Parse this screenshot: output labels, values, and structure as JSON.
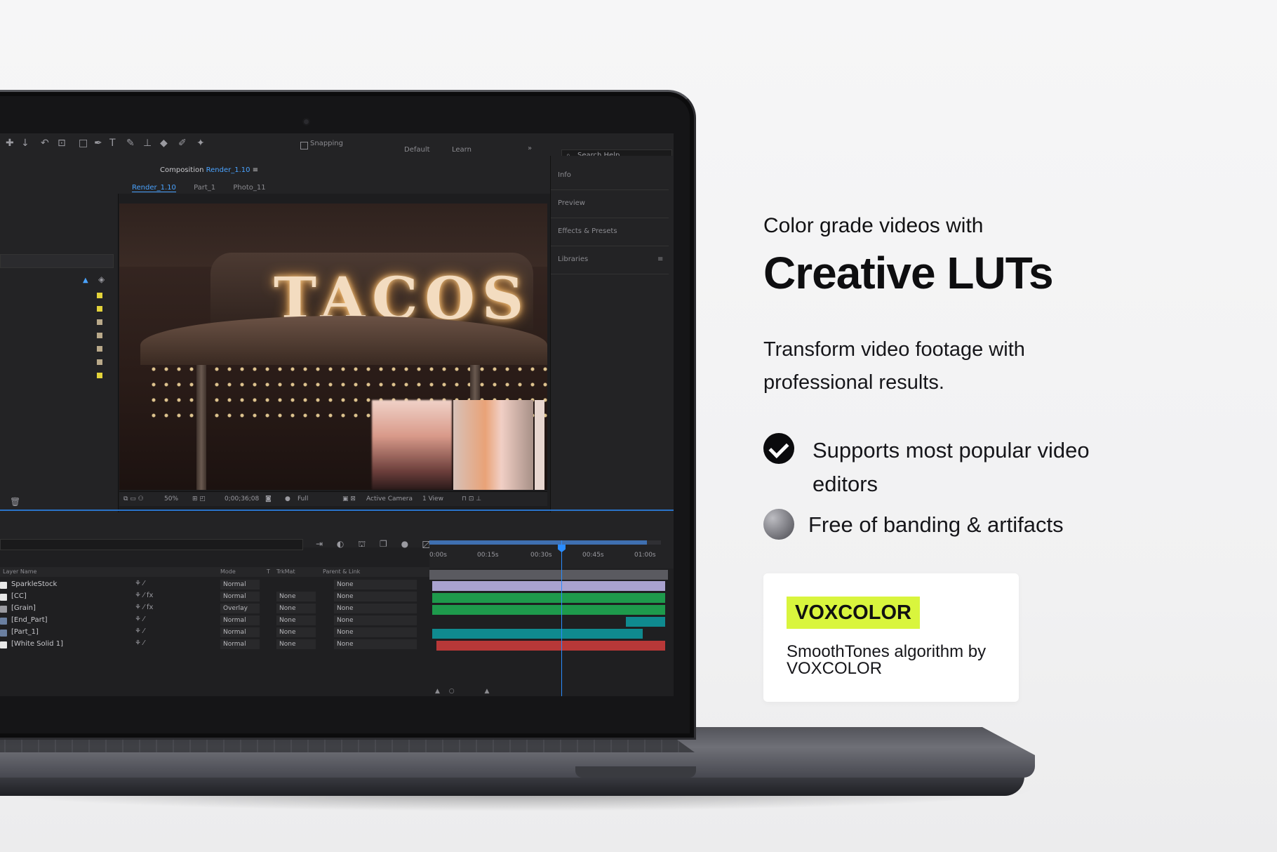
{
  "app": {
    "toolbar": {
      "snapping": "Snapping",
      "workspace_default": "Default",
      "workspace_learn": "Learn",
      "search_placeholder": "Search Help"
    },
    "composition": {
      "label": "Composition",
      "name": "Render_1.10",
      "tabs": [
        "Render_1.10",
        "Part_1",
        "Photo_11"
      ]
    },
    "viewer": {
      "sign_text": "TACOS",
      "zoom": "50%",
      "timecode": "0;00;36;08",
      "resolution": "Full",
      "camera": "Active Camera",
      "views": "1 View"
    },
    "right_panel": [
      "Info",
      "Preview",
      "Effects & Presets",
      "Libraries"
    ],
    "timeline": {
      "columns": {
        "layer_name": "Layer Name",
        "mode": "Mode",
        "t": "T",
        "trkmat": "TrkMat",
        "parent": "Parent & Link"
      },
      "ruler_ticks": [
        "0:00s",
        "00:15s",
        "00:30s",
        "00:45s",
        "01:00s"
      ],
      "layers": [
        {
          "name": "SparkleStock",
          "icons": "⚘  ⁄",
          "mode": "Normal",
          "trkmat": "",
          "parent": "None"
        },
        {
          "name": "[CC]",
          "icons": "⚘  ⁄ fx",
          "mode": "Normal",
          "trkmat": "None",
          "parent": "None"
        },
        {
          "name": "[Grain]",
          "icons": "⚘  ⁄ fx",
          "mode": "Overlay",
          "trkmat": "None",
          "parent": "None"
        },
        {
          "name": "[End_Part]",
          "icons": "⚘  ⁄",
          "mode": "Normal",
          "trkmat": "None",
          "parent": "None"
        },
        {
          "name": "[Part_1]",
          "icons": "⚘  ⁄",
          "mode": "Normal",
          "trkmat": "None",
          "parent": "None"
        },
        {
          "name": "[White Solid 1]",
          "icons": "⚘  ⁄",
          "mode": "Normal",
          "trkmat": "None",
          "parent": "None"
        }
      ]
    }
  },
  "marketing": {
    "subtitle": "Color grade videos with",
    "headline": "Creative LUTs",
    "description": "Transform video footage with professional results.",
    "features": [
      {
        "text": "Supports most popular video editors",
        "icon": "check-circle-icon"
      },
      {
        "text": "Free of banding & artifacts",
        "icon": "gray-sphere-icon"
      }
    ],
    "card": {
      "brand": "VOXCOLOR",
      "brand_color": "#d9f53d",
      "algorithm": "SmoothTones algorithm by VOXCOLOR"
    }
  },
  "colors": {
    "timeline_track_lavender": "#a9a2cf",
    "timeline_track_green": "#1e9a4c",
    "timeline_track_teal": "#0f8a8f",
    "timeline_track_red": "#b83838",
    "accent_blue": "#2a8cff"
  }
}
